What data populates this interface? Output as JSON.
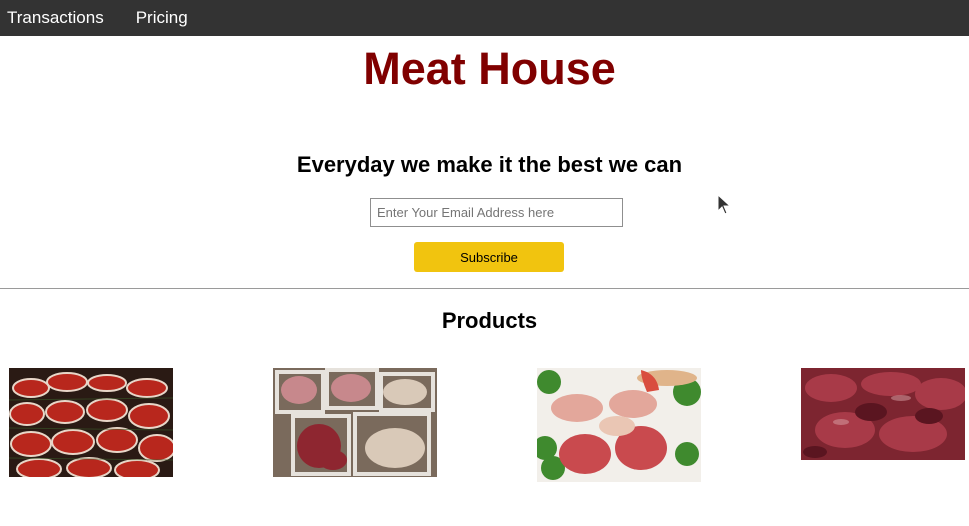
{
  "nav": {
    "items": [
      {
        "label": "Transactions"
      },
      {
        "label": "Pricing"
      }
    ]
  },
  "header": {
    "title": "Meat House",
    "title_color": "#800000"
  },
  "hero": {
    "tagline": "Everyday we make it the best we can",
    "email_placeholder": "Enter Your Email Address here",
    "email_value": "",
    "subscribe_label": "Subscribe",
    "button_color": "#f1c40f"
  },
  "products": {
    "title": "Products",
    "items": [
      {
        "image": "steaks-image"
      },
      {
        "image": "meat-cuts-tray-image"
      },
      {
        "image": "meat-platter-image"
      },
      {
        "image": "raw-beef-image"
      }
    ]
  }
}
